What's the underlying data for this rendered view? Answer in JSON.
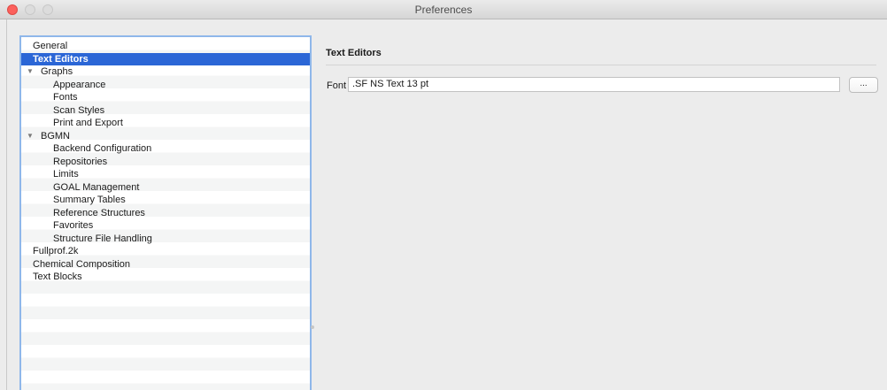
{
  "window": {
    "title": "Preferences"
  },
  "tree": {
    "items": [
      {
        "label": "General",
        "level": 0,
        "selected": false,
        "expandable": false
      },
      {
        "label": "Text Editors",
        "level": 0,
        "selected": true,
        "expandable": false
      },
      {
        "label": "Graphs",
        "level": 0,
        "selected": false,
        "expandable": true
      },
      {
        "label": "Appearance",
        "level": 1,
        "selected": false,
        "expandable": false
      },
      {
        "label": "Fonts",
        "level": 1,
        "selected": false,
        "expandable": false
      },
      {
        "label": "Scan Styles",
        "level": 1,
        "selected": false,
        "expandable": false
      },
      {
        "label": "Print and Export",
        "level": 1,
        "selected": false,
        "expandable": false
      },
      {
        "label": "BGMN",
        "level": 0,
        "selected": false,
        "expandable": true
      },
      {
        "label": "Backend Configuration",
        "level": 1,
        "selected": false,
        "expandable": false
      },
      {
        "label": "Repositories",
        "level": 1,
        "selected": false,
        "expandable": false
      },
      {
        "label": "Limits",
        "level": 1,
        "selected": false,
        "expandable": false
      },
      {
        "label": "GOAL Management",
        "level": 1,
        "selected": false,
        "expandable": false
      },
      {
        "label": "Summary Tables",
        "level": 1,
        "selected": false,
        "expandable": false
      },
      {
        "label": "Reference Structures",
        "level": 1,
        "selected": false,
        "expandable": false
      },
      {
        "label": "Favorites",
        "level": 1,
        "selected": false,
        "expandable": false
      },
      {
        "label": "Structure File Handling",
        "level": 1,
        "selected": false,
        "expandable": false
      },
      {
        "label": "Fullprof.2k",
        "level": 0,
        "selected": false,
        "expandable": false
      },
      {
        "label": "Chemical Composition",
        "level": 0,
        "selected": false,
        "expandable": false
      },
      {
        "label": "Text Blocks",
        "level": 0,
        "selected": false,
        "expandable": false
      }
    ]
  },
  "panel": {
    "heading": "Text Editors",
    "font_label": "Font",
    "font_value": ".SF NS Text 13 pt",
    "browse_label": "..."
  },
  "colors": {
    "selection": "#2b66d6",
    "focus_ring": "#8fb7ea",
    "close": "#fc605c"
  }
}
